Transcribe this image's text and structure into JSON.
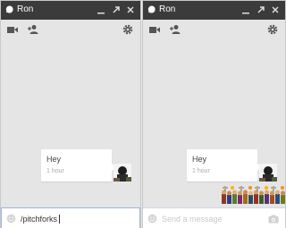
{
  "left_chat": {
    "title": "Ron",
    "message": {
      "text": "Hey",
      "time": "1 hour"
    },
    "composer": {
      "value": "/pitchforks",
      "placeholder": ""
    }
  },
  "right_chat": {
    "title": "Ron",
    "message": {
      "text": "Hey",
      "time": "1 hour"
    },
    "composer": {
      "value": "",
      "placeholder": "Send a message"
    }
  },
  "colors": {
    "titlebar": "#3b3b3b",
    "panel": "#e5e5e5",
    "bubble": "#ffffff",
    "focus_border": "#9db4e0"
  }
}
